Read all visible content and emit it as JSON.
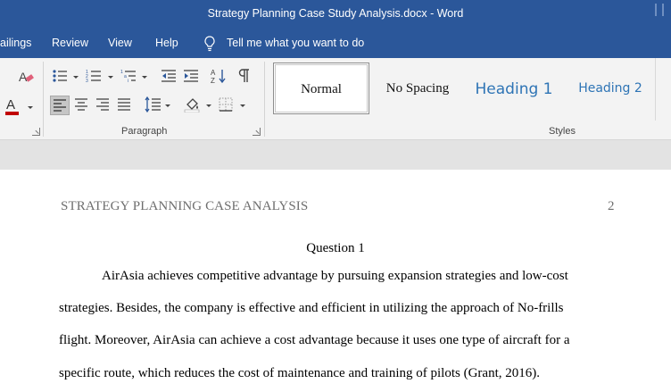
{
  "window": {
    "title": "Strategy Planning Case Study Analysis.docx  -  Word"
  },
  "tabs": {
    "mailings": "ailings",
    "review": "Review",
    "view": "View",
    "help": "Help",
    "tell_me": "Tell me what you want to do"
  },
  "ribbon": {
    "paragraph_label": "Paragraph",
    "styles_label": "Styles",
    "styles": {
      "normal": "Normal",
      "no_spacing": "No Spacing",
      "heading1": "Heading 1",
      "heading2": "Heading 2"
    },
    "font_color": "#c00000",
    "accent": "#2b579a"
  },
  "document": {
    "running_head": "STRATEGY PLANNING CASE ANALYSIS",
    "page_number": "2",
    "heading": "Question 1",
    "paragraph_lines": [
      "AirAsia achieves competitive advantage by pursuing expansion strategies and low-cost",
      "strategies. Besides, the company is effective and efficient in utilizing the approach of No-frills",
      "flight. Moreover, AirAsia can achieve a cost advantage because it uses one type of aircraft for a",
      "specific route, which reduces the cost of maintenance and training of pilots (Grant, 2016)."
    ]
  }
}
